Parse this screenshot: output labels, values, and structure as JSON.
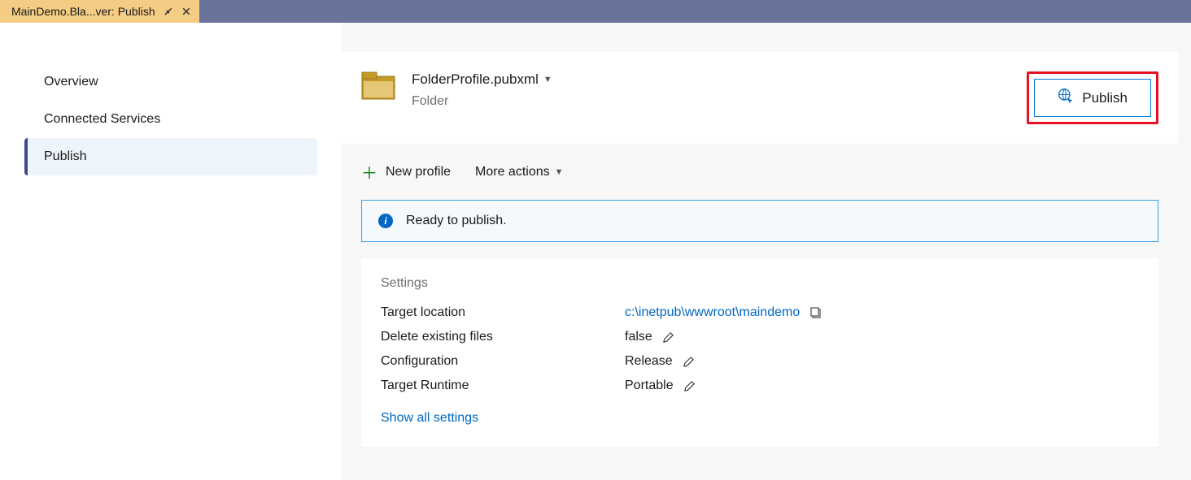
{
  "tab": {
    "title": "MainDemo.Bla...ver: Publish"
  },
  "sidebar": {
    "items": [
      {
        "label": "Overview"
      },
      {
        "label": "Connected Services"
      },
      {
        "label": "Publish"
      }
    ]
  },
  "profile": {
    "filename": "FolderProfile.pubxml",
    "type": "Folder"
  },
  "publish_button": "Publish",
  "actions": {
    "new_profile": "New profile",
    "more_actions": "More actions"
  },
  "banner": {
    "text": "Ready to publish."
  },
  "settings": {
    "heading": "Settings",
    "rows": {
      "target_location_label": "Target location",
      "target_location_value": "c:\\inetpub\\wwwroot\\maindemo",
      "delete_existing_label": "Delete existing files",
      "delete_existing_value": "false",
      "configuration_label": "Configuration",
      "configuration_value": "Release",
      "target_runtime_label": "Target Runtime",
      "target_runtime_value": "Portable"
    },
    "show_all": "Show all settings"
  }
}
